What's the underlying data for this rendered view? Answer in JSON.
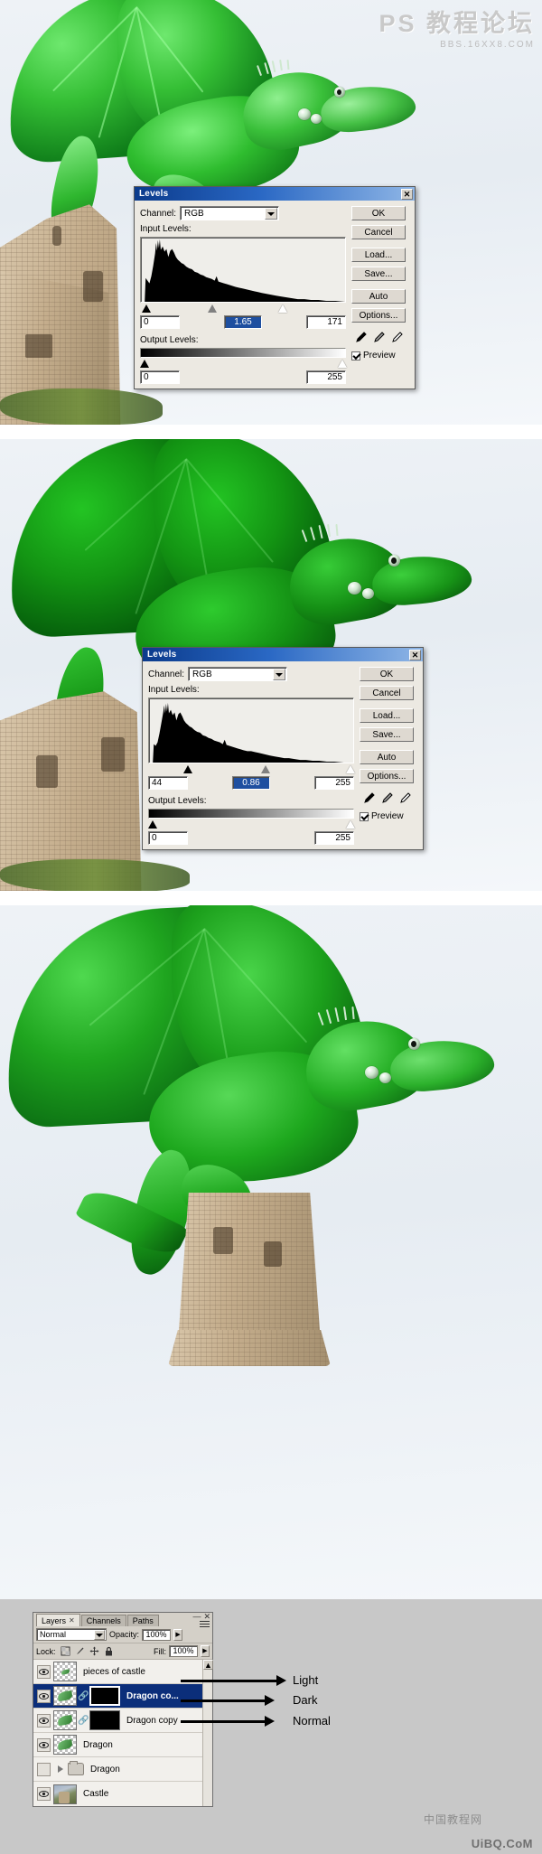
{
  "watermarks": {
    "top_line1": "PS 教程论坛",
    "top_line2": "BBS.16XX8.COM",
    "bottom_cn": "中国教程网",
    "bottom_site": "UiBQ.CoM"
  },
  "dialogs": [
    {
      "title": "Levels",
      "close_label": "✕",
      "channel_label": "Channel:",
      "channel_value": "RGB",
      "input_levels_label": "Input Levels:",
      "input_black": "0",
      "input_gamma": "1.65",
      "input_white": "171",
      "output_levels_label": "Output Levels:",
      "output_black": "0",
      "output_white": "255",
      "buttons": [
        "OK",
        "Cancel",
        "Load...",
        "Save...",
        "Auto",
        "Options..."
      ],
      "preview_label": "Preview",
      "preview_checked": true,
      "slider_positions": {
        "black": 1,
        "gamma": 33,
        "white": 67
      }
    },
    {
      "title": "Levels",
      "close_label": "✕",
      "channel_label": "Channel:",
      "channel_value": "RGB",
      "input_levels_label": "Input Levels:",
      "input_black": "44",
      "input_gamma": "0.86",
      "input_white": "255",
      "output_levels_label": "Output Levels:",
      "output_black": "0",
      "output_white": "255",
      "buttons": [
        "OK",
        "Cancel",
        "Load...",
        "Save...",
        "Auto",
        "Options..."
      ],
      "preview_label": "Preview",
      "preview_checked": true,
      "slider_positions": {
        "black": 17,
        "gamma": 55,
        "white": 98
      }
    }
  ],
  "layers_panel": {
    "tabs": [
      {
        "label": "Layers",
        "closable": true,
        "active": true
      },
      {
        "label": "Channels",
        "closable": false,
        "active": false
      },
      {
        "label": "Paths",
        "closable": false,
        "active": false
      }
    ],
    "blend_mode": "Normal",
    "opacity_label": "Opacity:",
    "opacity_value": "100%",
    "lock_label": "Lock:",
    "fill_label": "Fill:",
    "fill_value": "100%",
    "layers": [
      {
        "name": "pieces of castle",
        "visible": true,
        "has_mask": false,
        "linked": false,
        "active": false,
        "type": "layer"
      },
      {
        "name": "Dragon co...",
        "visible": true,
        "has_mask": true,
        "linked": true,
        "active": true,
        "type": "layer"
      },
      {
        "name": "Dragon copy",
        "visible": true,
        "has_mask": true,
        "linked": true,
        "active": false,
        "type": "layer"
      },
      {
        "name": "Dragon",
        "visible": true,
        "has_mask": false,
        "linked": false,
        "active": false,
        "type": "layer"
      },
      {
        "name": "Dragon",
        "visible": false,
        "has_mask": false,
        "linked": false,
        "active": false,
        "type": "group"
      },
      {
        "name": "Castle",
        "visible": true,
        "has_mask": false,
        "linked": false,
        "active": false,
        "type": "layer"
      }
    ]
  },
  "annotations": [
    {
      "label": "Light"
    },
    {
      "label": "Dark"
    },
    {
      "label": "Normal"
    }
  ]
}
